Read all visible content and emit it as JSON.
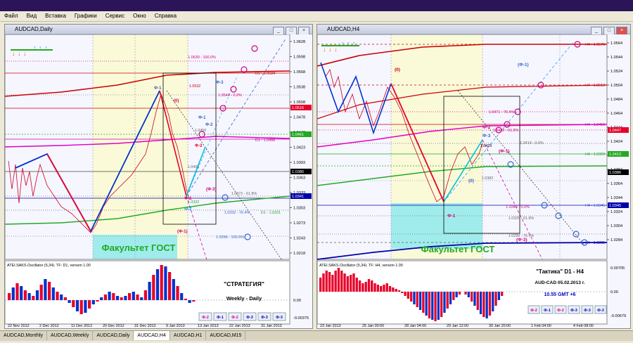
{
  "menu": [
    "Файл",
    "Вид",
    "Вставка",
    "Графики",
    "Сервис",
    "Окно",
    "Справка"
  ],
  "left_window": {
    "title": "AUDCAD,Daily",
    "y_ticks": [
      "1.0628",
      "1.0598",
      "1.0568",
      "1.0538",
      "1.0508",
      "1.0478",
      "1.0448",
      "1.0423",
      "1.0393",
      "1.0363",
      "1.0333",
      "1.0303",
      "1.0273",
      "1.0243",
      "1.0218"
    ],
    "price_tags": [
      "1.0516",
      "1.0461",
      "1.0386",
      "1.0341"
    ],
    "level_labels": [
      "1.0639 - 100.0%",
      "D1 - 1.0584",
      "1.0544 - 0.0%",
      "1.0532",
      "1.0450",
      "D1 - 1.0458",
      "1.0372 - 61.8%",
      "1.0332 - 76.4%",
      "D1 - 1.0331",
      "1.0266 - 100.0%",
      "1.0405",
      "1.0332"
    ],
    "phi_labels": [
      "Ф-3",
      "Ф-1",
      "(0)",
      "Ф-2",
      "(Ф-3)",
      "Ф-1",
      "Ф-2",
      "(Ф-1)",
      "Ф-1",
      "Ф-2"
    ],
    "watermark": "Факультет ГОСТ",
    "oscillator_label": "ATEI.SAKS.Oscillator (5,34). TF: D1, version 1.00",
    "osc_ticks": [
      "0.00",
      "-0.00375"
    ],
    "strategy_title": "\"СТРАТЕГИЯ\"",
    "strategy_sub": "Weekly - Daily",
    "phi_buttons": [
      "Ф-2",
      "Ф-1",
      "Ф-2",
      "Ф-3",
      "Ф-3",
      "Ф-3"
    ],
    "x_labels": [
      "22 Nov 2012",
      "2 Dec 2012",
      "11 Dec 2012",
      "20 Dec 2012",
      "31 Dec 2012",
      "9 Jan 2013",
      "13 Jan 2013",
      "22 Jan 2013",
      "31 Jan 2013"
    ]
  },
  "right_window": {
    "title": "AUDCAD,H4",
    "y_ticks": [
      "1.0564",
      "1.0544",
      "1.0524",
      "1.0504",
      "1.0484",
      "1.0464",
      "1.0444",
      "1.0424",
      "1.0404",
      "1.0384",
      "1.0364",
      "1.0344",
      "1.0324",
      "1.0304",
      "1.0284"
    ],
    "price_tags": [
      "1.0447",
      "1.0413",
      "1.0386",
      "1.0345"
    ],
    "level_labels": [
      "H4 - 1.0570",
      "H4 - 1.0513",
      "1.0471 - 76.4%",
      "H4 - 1.0456",
      "1.0440 - 61.8%",
      "1.0419 - 0.0%",
      "H4 - 1.0399",
      "1.0382",
      "1.0349 - 0.0%",
      "H4 - 1.0345",
      "1.0325 - 61.8%",
      "1.0299 - 76.4%",
      "H4 - 1.0285",
      "1.0429"
    ],
    "phi_labels": [
      "(0)",
      "(Ф-1)",
      "Ф-2",
      "Ф-3",
      "(Ф-1)",
      "(0)",
      "Ф-1",
      "(Ф-3)"
    ],
    "watermark": "Факультет ГОСТ",
    "oscillator_label": "ATEI.SAKS.Oscillator (5,34). TF: H4, version 1.00",
    "osc_ticks": [
      "0.00705",
      "0.00",
      "-0.00679"
    ],
    "tactic_title": "\"Тактика\"  D1 - H4",
    "tactic_sub": "AUD-CAD     05.02.2013  г.",
    "tactic_time": "10.55  GMT +6",
    "phi_buttons": [
      "Ф-2",
      "Ф-1",
      "Ф-2",
      "Ф-3",
      "Ф-3",
      "Ф-3"
    ],
    "x_labels": [
      "23 Jan 2013",
      "25 Jan 00:00",
      "28 Jan 04:00",
      "29 Jan 12:00",
      "30 Jan 20:00",
      "1 Feb 04:00",
      "4 Feb 08:00"
    ]
  },
  "tabs": [
    "AUDCAD,Monthly",
    "AUDCAD,Weekly",
    "AUDCAD,Daily",
    "AUDCAD,H4",
    "AUDCAD,H1",
    "AUDCAD,M15"
  ],
  "active_tab": "AUDCAD,H4",
  "colors": {
    "bull": "#0033cc",
    "bear": "#e8002a",
    "ma_red": "#cc0000",
    "ma_magenta": "#e000c8",
    "ma_green": "#22aa22",
    "fib": "#d0007a",
    "cyan": "#00c0e0"
  }
}
